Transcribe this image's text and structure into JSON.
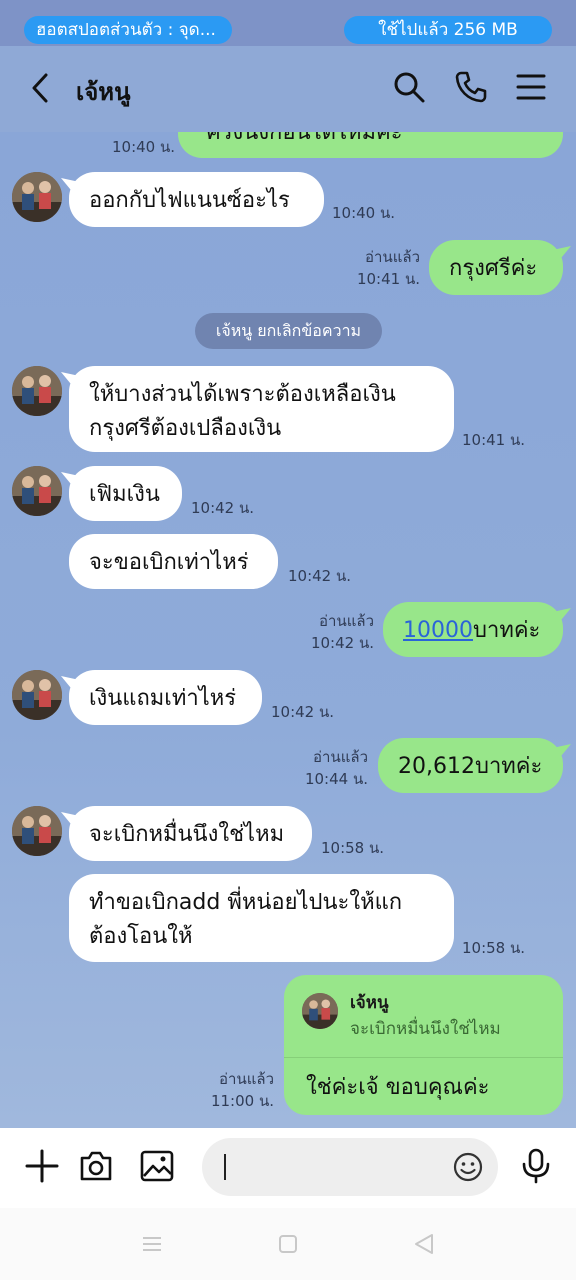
{
  "status": {
    "hotspot": "ฮอตสปอตส่วนตัว : จุด...",
    "data_used": "ใช้ไปแล้ว 256 MB"
  },
  "header": {
    "title": "เจ้หนู"
  },
  "messages": {
    "m0_text": "ครึ่งนึงก่อนได้ไหมคะ",
    "m0_time": "10:40 น.",
    "m1_text": "ออกกับไฟแนนซ์อะไร",
    "m1_time": "10:40 น.",
    "m2_read": "อ่านแล้ว",
    "m2_time": "10:41 น.",
    "m2_text": "กรุงศรีค่ะ",
    "system": "เจ้หนู ยกเลิกข้อความ",
    "m3_line1": "ให้บางส่วนได้เพราะต้องเหลือเงิน",
    "m3_line2": "กรุงศรีต้องเปลืองเงิน",
    "m3_time": "10:41 น.",
    "m4_text": "เฟิมเงิน",
    "m4_time": "10:42 น.",
    "m5_text": "จะขอเบิกเท่าไหร่",
    "m5_time": "10:42 น.",
    "m6_read": "อ่านแล้ว",
    "m6_time": "10:42 น.",
    "m6_link": "10000",
    "m6_suffix": "บาทค่ะ",
    "m7_text": "เงินแถมเท่าไหร่",
    "m7_time": "10:42 น.",
    "m8_read": "อ่านแล้ว",
    "m8_time": "10:44 น.",
    "m8_text": "20,612บาทค่ะ",
    "m9_text": "จะเบิกหมื่นนึงใช่ไหม",
    "m9_time": "10:58 น.",
    "m10_line1": "ทำขอเบิกadd พี่หน่อยไปนะให้แก",
    "m10_line2": "ต้องโอนให้",
    "m10_time": "10:58 น.",
    "m11_read": "อ่านแล้ว",
    "m11_time": "11:00 น.",
    "m11_reply_name": "เจ้หนู",
    "m11_reply_text": "จะเบิกหมื่นนึงใช่ไหม",
    "m11_text": "ใช่ค่ะเจ้ ขอบคุณค่ะ"
  },
  "colors": {
    "chat_bg": "#8fa9d6",
    "outgoing_bubble": "#98e68a",
    "incoming_bubble": "#ffffff",
    "status_pill": "#2b9af3"
  },
  "icons": [
    "back-icon",
    "search-icon",
    "phone-icon",
    "menu-icon",
    "plus-icon",
    "camera-icon",
    "image-icon",
    "emoji-icon",
    "mic-icon"
  ]
}
